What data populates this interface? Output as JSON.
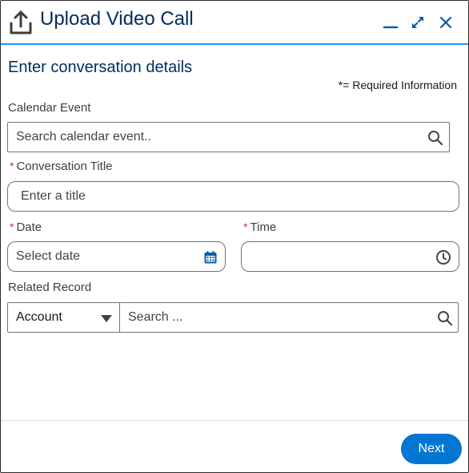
{
  "header": {
    "title": "Upload Video Call",
    "icon": "upload-icon",
    "minimize_icon": "minimize-icon",
    "expand_icon": "expand-icon",
    "close_icon": "close-icon"
  },
  "form": {
    "section_title": "Enter conversation details",
    "required_info": "= Required Information",
    "required_marker": "*",
    "calendar_event": {
      "label": "Calendar Event",
      "placeholder": "Search calendar event..",
      "value": ""
    },
    "conversation_title": {
      "label": "Conversation Title",
      "placeholder": "Enter a title",
      "value": ""
    },
    "date": {
      "label": "Date",
      "placeholder": "Select date",
      "value": ""
    },
    "time": {
      "label": "Time",
      "placeholder": "",
      "value": ""
    },
    "related_record": {
      "label": "Related Record",
      "object_type": "Account",
      "search_placeholder": "Search ..."
    }
  },
  "footer": {
    "next_label": "Next"
  },
  "colors": {
    "primary": "#0176d3",
    "header_border": "#1b96ff",
    "title_text": "#032d60",
    "required": "#c23934"
  }
}
